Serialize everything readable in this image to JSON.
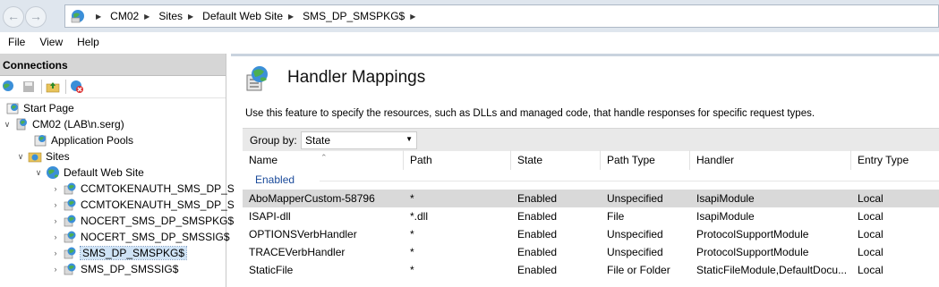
{
  "address_bar": {
    "segments": [
      "CM02",
      "Sites",
      "Default Web Site",
      "SMS_DP_SMSPKG$"
    ]
  },
  "menu": [
    "File",
    "View",
    "Help"
  ],
  "connections": {
    "title": "Connections",
    "tree": [
      {
        "label": "Start Page"
      },
      {
        "label": "CM02 (LAB\\n.serg)"
      },
      {
        "label": "Application Pools"
      },
      {
        "label": "Sites"
      },
      {
        "label": "Default Web Site"
      },
      {
        "label": "CCMTOKENAUTH_SMS_DP_S"
      },
      {
        "label": "CCMTOKENAUTH_SMS_DP_S"
      },
      {
        "label": "NOCERT_SMS_DP_SMSPKG$"
      },
      {
        "label": "NOCERT_SMS_DP_SMSSIG$"
      },
      {
        "label": "SMS_DP_SMSPKG$"
      },
      {
        "label": "SMS_DP_SMSSIG$"
      }
    ]
  },
  "main": {
    "title": "Handler Mappings",
    "description": "Use this feature to specify the resources, such as DLLs and managed code, that handle responses for specific request types.",
    "group_by_label": "Group by:",
    "group_by_value": "State",
    "columns": [
      "Name",
      "Path",
      "State",
      "Path Type",
      "Handler",
      "Entry Type"
    ],
    "group_header": "Enabled",
    "rows": [
      {
        "name": "AboMapperCustom-58796",
        "path": "*",
        "state": "Enabled",
        "path_type": "Unspecified",
        "handler": "IsapiModule",
        "entry_type": "Local"
      },
      {
        "name": "ISAPI-dll",
        "path": "*.dll",
        "state": "Enabled",
        "path_type": "File",
        "handler": "IsapiModule",
        "entry_type": "Local"
      },
      {
        "name": "OPTIONSVerbHandler",
        "path": "*",
        "state": "Enabled",
        "path_type": "Unspecified",
        "handler": "ProtocolSupportModule",
        "entry_type": "Local"
      },
      {
        "name": "TRACEVerbHandler",
        "path": "*",
        "state": "Enabled",
        "path_type": "Unspecified",
        "handler": "ProtocolSupportModule",
        "entry_type": "Local"
      },
      {
        "name": "StaticFile",
        "path": "*",
        "state": "Enabled",
        "path_type": "File or Folder",
        "handler": "StaticFileModule,DefaultDocu...",
        "entry_type": "Local"
      }
    ]
  }
}
